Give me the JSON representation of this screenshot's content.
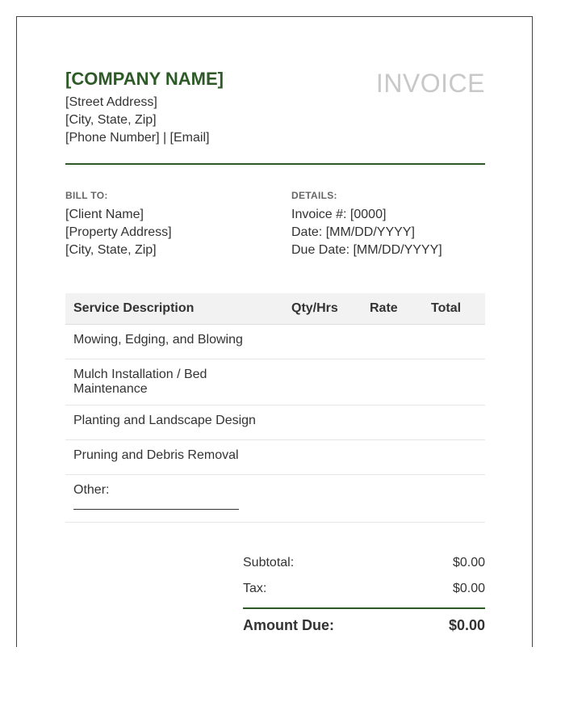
{
  "company": {
    "name": "[COMPANY NAME]",
    "street": "[Street Address]",
    "city": "[City, State, Zip]",
    "contact": "[Phone Number] | [Email]"
  },
  "document_title": "INVOICE",
  "bill_to": {
    "label": "BILL TO:",
    "client": "[Client Name]",
    "property": "[Property Address]",
    "city": "[City, State, Zip]"
  },
  "details": {
    "label": "DETAILS:",
    "invoice_number": "Invoice #: [0000]",
    "date": "Date: [MM/DD/YYYY]",
    "due_date": "Due Date: [MM/DD/YYYY]"
  },
  "table": {
    "headers": [
      "Service Description",
      "Qty/Hrs",
      "Rate",
      "Total"
    ],
    "rows": [
      {
        "description": "Mowing, Edging, and Blowing",
        "qty": "",
        "rate": "",
        "total": ""
      },
      {
        "description": "Mulch Installation / Bed Maintenance",
        "qty": "",
        "rate": "",
        "total": ""
      },
      {
        "description": "Planting and Landscape Design",
        "qty": "",
        "rate": "",
        "total": ""
      },
      {
        "description": "Pruning and Debris Removal",
        "qty": "",
        "rate": "",
        "total": ""
      },
      {
        "description": "Other:",
        "qty": "",
        "rate": "",
        "total": ""
      }
    ]
  },
  "totals": {
    "subtotal_label": "Subtotal:",
    "subtotal_value": "$0.00",
    "tax_label": "Tax:",
    "tax_value": "$0.00",
    "amount_due_label": "Amount Due:",
    "amount_due_value": "$0.00"
  },
  "colors": {
    "accent": "#2d5a27",
    "title_gray": "#c8c8c8",
    "header_bg": "#f2f2f2"
  }
}
